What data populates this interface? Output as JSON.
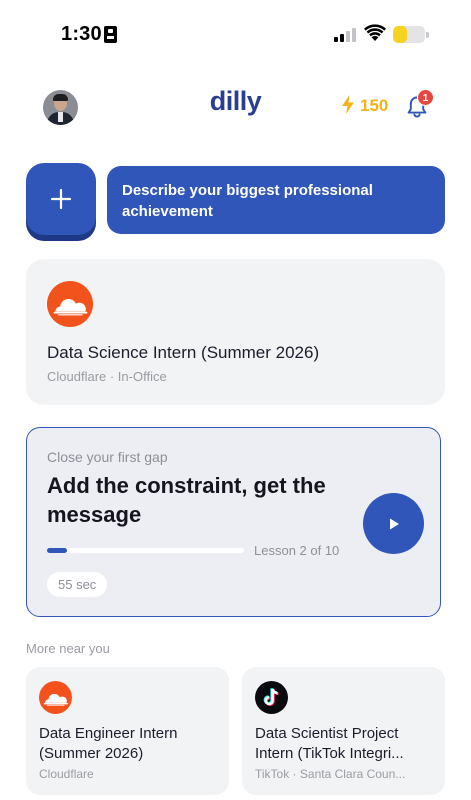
{
  "status_bar": {
    "time": "1:30",
    "battery_level": 0.45,
    "battery_color": "#f6d321"
  },
  "header": {
    "logo": "dilly",
    "points": "150",
    "notification_count": "1",
    "accent": "#2a3f8f",
    "points_color": "#f2b31b",
    "badge_color": "#e8473f"
  },
  "prompt": {
    "text": "Describe your biggest professional achievement",
    "button_icon": "plus-icon",
    "color": "#2f56b8"
  },
  "featured_job": {
    "title": "Data Science Intern (Summer 2026)",
    "meta": "Cloudflare · In-Office",
    "logo_icon": "cloudflare-logo",
    "logo_color": "#f2531c"
  },
  "lesson": {
    "eyebrow": "Close your first gap",
    "title": "Add the constraint, get the message",
    "progress_fraction": 0.1,
    "progress_label": "Lesson 2 of 10",
    "duration": "55 sec",
    "play_icon": "play-icon"
  },
  "more_near_you": {
    "label": "More near you",
    "cards": [
      {
        "title_line1": "Data Engineer Intern",
        "title_line2": "(Summer 2026)",
        "meta": "Cloudflare",
        "logo_icon": "cloudflare-logo"
      },
      {
        "title_line1": "Data Scientist Project",
        "title_line2": "Intern (TikTok Integri...",
        "meta": "TikTok · Santa Clara Coun...",
        "logo_icon": "tiktok-logo"
      }
    ]
  }
}
